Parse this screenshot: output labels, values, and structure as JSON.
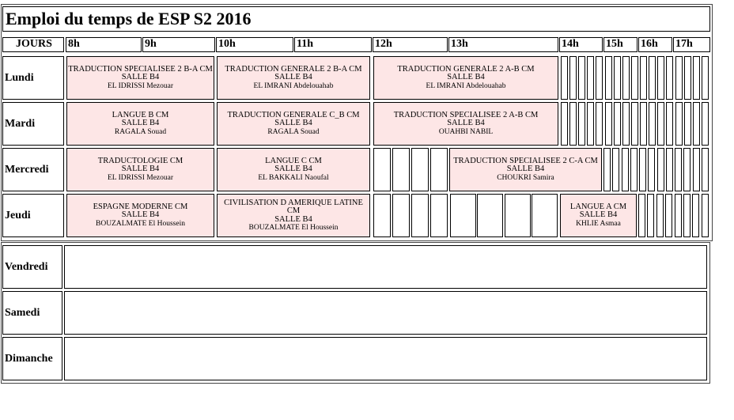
{
  "title": "Emploi du temps de ESP S2 2016",
  "header": {
    "jours": "JOURS",
    "hours": [
      "8h",
      "9h",
      "10h",
      "11h",
      "12h",
      "13h",
      "14h",
      "15h",
      "16h",
      "17h"
    ]
  },
  "days": [
    "Lundi",
    "Mardi",
    "Mercredi",
    "Jeudi",
    "Vendredi",
    "Samedi",
    "Dimanche"
  ],
  "courses": {
    "lundi_1": {
      "name": "TRADUCTION SPECIALISEE 2 B-A CM",
      "room": "SALLE B4",
      "prof": "EL IDRISSI Mezouar"
    },
    "lundi_2": {
      "name": "TRADUCTION GENERALE 2 B-A CM",
      "room": "SALLE B4",
      "prof": "EL IMRANI Abdelouahab"
    },
    "lundi_3": {
      "name": "TRADUCTION GENERALE 2 A-B CM",
      "room": "SALLE B4",
      "prof": "EL IMRANI Abdelouahab"
    },
    "mardi_1": {
      "name": "LANGUE B CM",
      "room": "SALLE B4",
      "prof": "RAGALA Souad"
    },
    "mardi_2": {
      "name": "TRADUCTION GENERALE C_B CM",
      "room": "SALLE B4",
      "prof": "RAGALA Souad"
    },
    "mardi_3": {
      "name": "TRADUCTION SPECIALISEE 2 A-B CM",
      "room": "SALLE B4",
      "prof": "OUAHBI NABIL"
    },
    "mercredi_1": {
      "name": "TRADUCTOLOGIE CM",
      "room": "SALLE B4",
      "prof": "EL IDRISSI Mezouar"
    },
    "mercredi_2": {
      "name": "LANGUE C CM",
      "room": "SALLE B4",
      "prof": "EL BAKKALI Naoufal"
    },
    "mercredi_3": {
      "name": "TRADUCTION SPECIALISEE 2 C-A CM",
      "room": "SALLE B4",
      "prof": "CHOUKRI Samira"
    },
    "jeudi_1": {
      "name": "ESPAGNE MODERNE CM",
      "room": "SALLE B4",
      "prof": "BOUZALMATE El Houssein"
    },
    "jeudi_2": {
      "name": "CIVILISATION D AMERIQUE LATINE CM",
      "room": "SALLE B4",
      "prof": "BOUZALMATE El Houssein"
    },
    "jeudi_3": {
      "name": "LANGUE A CM",
      "room": "SALLE B4",
      "prof": "KHLIE Asmaa"
    }
  }
}
